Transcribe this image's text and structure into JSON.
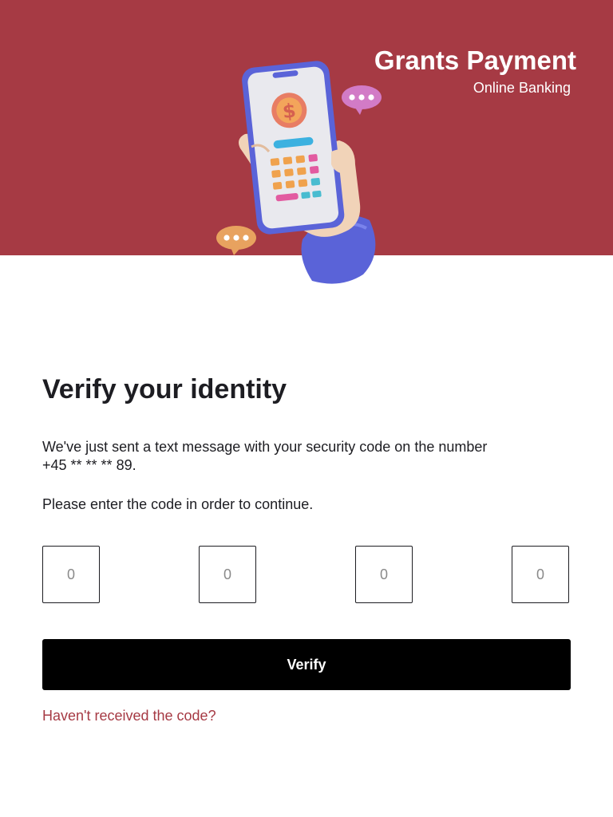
{
  "brand": {
    "title": "Grants Payment",
    "subtitle": "Online Banking",
    "banner_color": "#a63a44"
  },
  "hero": {
    "icon": "hand-holding-phone-payment-illustration"
  },
  "verify": {
    "title": "Verify your identity",
    "message_line1": "We've just sent a text message with your security code on the number",
    "message_line2": "+45 ** ** ** 89.",
    "instruction": "Please enter the code in order to continue.",
    "code_fields": [
      {
        "value": "",
        "placeholder": "0"
      },
      {
        "value": "",
        "placeholder": "0"
      },
      {
        "value": "",
        "placeholder": "0"
      },
      {
        "value": "",
        "placeholder": "0"
      }
    ],
    "button_label": "Verify",
    "resend_link": "Haven't received the code?",
    "link_color": "#a63a44",
    "button_color": "#000000"
  }
}
